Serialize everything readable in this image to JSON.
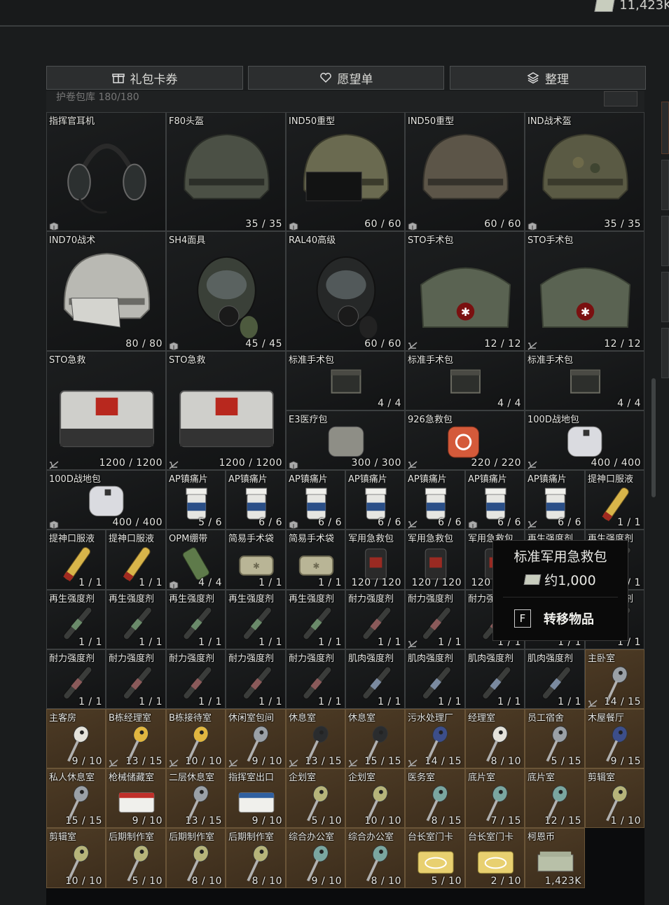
{
  "currency": {
    "amount": "11,423K",
    "icon": "rouble-bill-icon"
  },
  "buttons": [
    {
      "label": "礼包卡券",
      "icon": "gift-icon"
    },
    {
      "label": "愿望单",
      "icon": "heart-icon"
    },
    {
      "label": "整理",
      "icon": "layers-icon"
    }
  ],
  "stash": {
    "title": "护卷包库  180/180"
  },
  "items": [
    {
      "name": "指挥官耳机",
      "count": "",
      "icon": "box",
      "pic": "headset"
    },
    {
      "name": "F80头盔",
      "count": "35/35",
      "icon": "",
      "pic": "helmet-dark"
    },
    {
      "name": "IND50重型",
      "count": "60/60",
      "icon": "box",
      "pic": "helmet-visor"
    },
    {
      "name": "IND50重型",
      "count": "60/60",
      "icon": "box",
      "pic": "helmet-brown"
    },
    {
      "name": "IND战术盔",
      "count": "35/35",
      "icon": "box",
      "pic": "helmet-camo"
    },
    {
      "name": "IND70战术",
      "count": "80/80",
      "icon": "",
      "pic": "helmet-white"
    },
    {
      "name": "SH4面具",
      "count": "45/45",
      "icon": "box",
      "pic": "gasmask-green"
    },
    {
      "name": "RAL40高级",
      "count": "60/60",
      "icon": "",
      "pic": "gasmask-black"
    },
    {
      "name": "STO手术包",
      "count": "12/12",
      "icon": "nocart",
      "pic": "case-green"
    },
    {
      "name": "STO手术包",
      "count": "12/12",
      "icon": "nocart",
      "pic": "case-green"
    },
    {
      "name": "STO急救",
      "count": "1200/1200",
      "icon": "nocart",
      "pic": "medbox-white"
    },
    {
      "name": "STO急救",
      "count": "1200/1200",
      "icon": "nocart",
      "pic": "medbox-white"
    },
    {
      "name": "标准手术包",
      "count": "4/4",
      "icon": "",
      "pic": "pouch-dark"
    },
    {
      "name": "标准手术包",
      "count": "4/4",
      "icon": "",
      "pic": "pouch-dark"
    },
    {
      "name": "标准手术包",
      "count": "4/4",
      "icon": "",
      "pic": "pouch-dark"
    },
    {
      "name": "E3医疗包",
      "count": "300/300",
      "icon": "box",
      "pic": "bag-grey"
    },
    {
      "name": "926急救包",
      "count": "220/220",
      "icon": "nocart",
      "pic": "bag-orange"
    },
    {
      "name": "100D战地包",
      "count": "400/400",
      "icon": "nocart",
      "pic": "bag-white"
    },
    {
      "name": "100D战地包",
      "count": "400/400",
      "icon": "box",
      "pic": "bag-white"
    },
    {
      "name": "AP镇痛片",
      "count": "5/6",
      "icon": "",
      "pic": "pill-bottle"
    },
    {
      "name": "AP镇痛片",
      "count": "6/6",
      "icon": "",
      "pic": "pill-bottle"
    },
    {
      "name": "AP镇痛片",
      "count": "6/6",
      "icon": "box",
      "pic": "pill-bottle"
    },
    {
      "name": "AP镇痛片",
      "count": "6/6",
      "icon": "",
      "pic": "pill-bottle"
    },
    {
      "name": "AP镇痛片",
      "count": "6/6",
      "icon": "nocart",
      "pic": "pill-bottle"
    },
    {
      "name": "AP镇痛片",
      "count": "6/6",
      "icon": "box",
      "pic": "pill-bottle"
    },
    {
      "name": "AP镇痛片",
      "count": "6/6",
      "icon": "nocart",
      "pic": "pill-bottle"
    },
    {
      "name": "提神口服液",
      "count": "1/1",
      "icon": "",
      "pic": "vial-yellow"
    },
    {
      "name": "提神口服液",
      "count": "1/1",
      "icon": "",
      "pic": "vial-yellow"
    },
    {
      "name": "提神口服液",
      "count": "1/1",
      "icon": "",
      "pic": "vial-yellow"
    },
    {
      "name": "OPM绷带",
      "count": "4/4",
      "icon": "box",
      "pic": "bandage"
    },
    {
      "name": "简易手术袋",
      "count": "1/1",
      "icon": "",
      "pic": "kit-tan"
    },
    {
      "name": "简易手术袋",
      "count": "1/1",
      "icon": "",
      "pic": "kit-tan"
    },
    {
      "name": "军用急救包",
      "count": "120/120",
      "icon": "",
      "pic": "pouch-red"
    },
    {
      "name": "军用急救包",
      "count": "120/120",
      "icon": "",
      "pic": "pouch-red"
    },
    {
      "name": "军用急救包",
      "count": "120/120",
      "icon": "",
      "pic": "pouch-red"
    },
    {
      "name": "再生强度剂",
      "count": "1/1",
      "icon": "",
      "pic": "inj-green"
    },
    {
      "name": "再生强度剂",
      "count": "1/1",
      "icon": "",
      "pic": "inj-green"
    },
    {
      "name": "再生强度剂",
      "count": "1/1",
      "icon": "",
      "pic": "inj-green"
    },
    {
      "name": "再生强度剂",
      "count": "1/1",
      "icon": "",
      "pic": "inj-green"
    },
    {
      "name": "再生强度剂",
      "count": "1/1",
      "icon": "",
      "pic": "inj-green"
    },
    {
      "name": "再生强度剂",
      "count": "1/1",
      "icon": "",
      "pic": "inj-green"
    },
    {
      "name": "再生强度剂",
      "count": "1/1",
      "icon": "",
      "pic": "inj-green"
    },
    {
      "name": "耐力强度剂",
      "count": "1/1",
      "icon": "",
      "pic": "inj-red"
    },
    {
      "name": "耐力强度剂",
      "count": "1/1",
      "icon": "nocart",
      "pic": "inj-red"
    },
    {
      "name": "耐力强度剂",
      "count": "1/1",
      "icon": "",
      "pic": "inj-red"
    },
    {
      "name": "再生强度剂",
      "count": "1/1",
      "icon": "",
      "pic": "inj-green"
    },
    {
      "name": "耐力强度剂",
      "count": "1/1",
      "icon": "",
      "pic": "inj-red"
    },
    {
      "name": "耐力强度剂",
      "count": "1/1",
      "icon": "",
      "pic": "inj-red"
    },
    {
      "name": "耐力强度剂",
      "count": "1/1",
      "icon": "",
      "pic": "inj-red"
    },
    {
      "name": "耐力强度剂",
      "count": "1/1",
      "icon": "",
      "pic": "inj-red"
    },
    {
      "name": "耐力强度剂",
      "count": "1/1",
      "icon": "",
      "pic": "inj-red"
    },
    {
      "name": "耐力强度剂",
      "count": "1/1",
      "icon": "",
      "pic": "inj-red"
    },
    {
      "name": "肌肉强度剂",
      "count": "1/1",
      "icon": "",
      "pic": "inj-blue"
    },
    {
      "name": "肌肉强度剂",
      "count": "1/1",
      "icon": "",
      "pic": "inj-blue"
    },
    {
      "name": "肌肉强度剂",
      "count": "1/1",
      "icon": "",
      "pic": "inj-blue"
    },
    {
      "name": "肌肉强度剂",
      "count": "1/1",
      "icon": "",
      "pic": "inj-blue"
    },
    {
      "name": "主卧室",
      "count": "14/15",
      "icon": "nocart",
      "pic": "key-silver"
    },
    {
      "name": "主客房",
      "count": "9/10",
      "icon": "",
      "pic": "key-white"
    },
    {
      "name": "B栋经理室",
      "count": "13/15",
      "icon": "nocart",
      "pic": "key-yellow"
    },
    {
      "name": "B栋接待室",
      "count": "10/10",
      "icon": "nocart",
      "pic": "key-yellow"
    },
    {
      "name": "休闲室包间",
      "count": "9/10",
      "icon": "nocart",
      "pic": "key-silver"
    },
    {
      "name": "休息室",
      "count": "13/15",
      "icon": "nocart",
      "pic": "key-black"
    },
    {
      "name": "休息室",
      "count": "15/15",
      "icon": "nocart",
      "pic": "key-black"
    },
    {
      "name": "污水处理厂",
      "count": "14/15",
      "icon": "nocart",
      "pic": "key-blue"
    },
    {
      "name": "经理室",
      "count": "8/10",
      "icon": "",
      "pic": "key-white"
    },
    {
      "name": "员工宿舍",
      "count": "5/15",
      "icon": "",
      "pic": "key-silver"
    },
    {
      "name": "木屋餐厅",
      "count": "9/15",
      "icon": "",
      "pic": "key-blue"
    },
    {
      "name": "私人休息室",
      "count": "15/15",
      "icon": "",
      "pic": "key-silver"
    },
    {
      "name": "枪械储藏室",
      "count": "9/10",
      "icon": "",
      "pic": "keycard-red"
    },
    {
      "name": "二层休息室",
      "count": "13/15",
      "icon": "",
      "pic": "key-silver"
    },
    {
      "name": "指挥室出口",
      "count": "9/10",
      "icon": "",
      "pic": "keycard-blue"
    },
    {
      "name": "企划室",
      "count": "5/10",
      "icon": "",
      "pic": "key-olive"
    },
    {
      "name": "企划室",
      "count": "10/10",
      "icon": "",
      "pic": "key-olive"
    },
    {
      "name": "医务室",
      "count": "8/15",
      "icon": "",
      "pic": "key-teal"
    },
    {
      "name": "底片室",
      "count": "7/15",
      "icon": "",
      "pic": "key-teal"
    },
    {
      "name": "底片室",
      "count": "12/15",
      "icon": "",
      "pic": "key-teal"
    },
    {
      "name": "剪辑室",
      "count": "1/10",
      "icon": "",
      "pic": "key-olive"
    },
    {
      "name": "剪辑室",
      "count": "10/10",
      "icon": "",
      "pic": "key-olive"
    },
    {
      "name": "后期制作室",
      "count": "5/10",
      "icon": "",
      "pic": "key-olive"
    },
    {
      "name": "后期制作室",
      "count": "8/10",
      "icon": "",
      "pic": "key-olive"
    },
    {
      "name": "后期制作室",
      "count": "8/10",
      "icon": "",
      "pic": "key-olive"
    },
    {
      "name": "综合办公室",
      "count": "9/10",
      "icon": "",
      "pic": "key-teal"
    },
    {
      "name": "综合办公室",
      "count": "8/10",
      "icon": "",
      "pic": "key-teal"
    },
    {
      "name": "台长室门卡",
      "count": "5/10",
      "icon": "",
      "pic": "card-gold"
    },
    {
      "name": "台长室门卡",
      "count": "2/10",
      "icon": "",
      "pic": "card-gold"
    },
    {
      "name": "柯恩币",
      "count": "1,423K",
      "icon": "",
      "pic": "money-stack"
    }
  ],
  "tooltip": {
    "title": "标准军用急救包",
    "price": "约1,000",
    "action_key": "F",
    "action_label": "转移物品"
  }
}
